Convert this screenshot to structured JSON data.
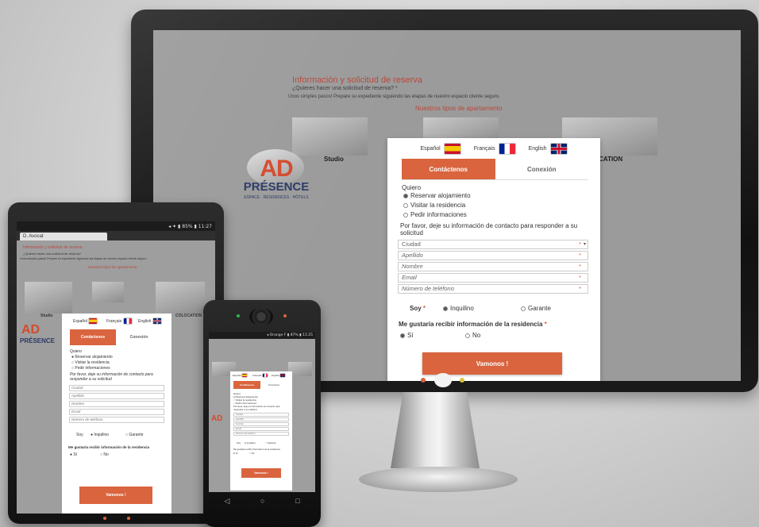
{
  "desktop": {
    "page_title": "Información y solicitud de reserva",
    "question": "¿Quieres hacer una solicitud de reserva? *",
    "intro": "Unos simples pasos! Prepare su expediente siguiendo las etapas de nuestro espacio cliente seguro.",
    "types_heading": "Nuestros tipos de apartamento",
    "tiles": [
      {
        "label": "Studio"
      },
      {
        "label": ""
      },
      {
        "label": "COLOCATION"
      }
    ],
    "logo": {
      "ad": "AD",
      "presence": "PRÉSENCE",
      "tagline": "ESPACE · RÉSIDENCES · HÔTELS"
    },
    "languages": [
      {
        "label": "Español",
        "flag": "flag-es-icon"
      },
      {
        "label": "Français",
        "flag": "flag-fr-icon"
      },
      {
        "label": "English",
        "flag": "flag-gb-icon"
      }
    ],
    "tabs": {
      "active": "Contáctenos",
      "other": "Conexión"
    },
    "quiero_label": "Quiero",
    "quiero_options": [
      {
        "label": "Reservar alojamiento",
        "selected": true
      },
      {
        "label": "Visitar la residencia",
        "selected": false
      },
      {
        "label": "Pedir informaciones",
        "selected": false
      }
    ],
    "contact_prompt": "Por favor, deje su información de contacto para responder a su solicitud",
    "fields": [
      {
        "placeholder": "Ciudad",
        "required": "*",
        "dropdown": "▾"
      },
      {
        "placeholder": "Apellido",
        "required": "*"
      },
      {
        "placeholder": "Nombre",
        "required": "*"
      },
      {
        "placeholder": "Email",
        "required": "*"
      },
      {
        "placeholder": "Número de teléfono",
        "required": "*"
      }
    ],
    "soy_label": "Soy",
    "soy_required": "*",
    "soy_options": [
      {
        "label": "Inquilino",
        "selected": true
      },
      {
        "label": "Garante",
        "selected": false
      }
    ],
    "info_question": "Me gustaría recibir información de la residencia",
    "info_required": "*",
    "info_options": [
      {
        "label": "Sí",
        "selected": true
      },
      {
        "label": "No",
        "selected": false
      }
    ],
    "submit_label": "Vamonos !"
  },
  "tablet": {
    "status": "◂ ✦ ▮ 85% ▮ 11:27",
    "browser_tab": "D. Avocat",
    "page_title": "Información y solicitud de reserva",
    "question": "¿Quieres hacer una solicitud de reserva?",
    "intro": "Unos simples pasos! Prepare su expediente siguiendo las etapas de nuestro espacio cliente seguro.",
    "types_heading": "Nuestros tipos de apartamento",
    "tile_labels": [
      "Studio",
      "",
      "COLOCATION"
    ],
    "logo": {
      "ad": "AD",
      "presence": "PRÉSENCE"
    },
    "languages": [
      "Español",
      "Français",
      "English"
    ],
    "tabs": {
      "active": "Contáctenos",
      "other": "Conexión"
    },
    "quiero_label": "Quiero",
    "quiero_options": [
      "Reservar alojamiento",
      "Visitar la residencia",
      "Pedir informaciones"
    ],
    "contact_prompt": "Por favor, deje su información de contacto para responder a su solicitud",
    "fields": [
      "Ciudad",
      "Apellido",
      "Nombre",
      "Email",
      "Número de teléfono"
    ],
    "soy_label": "Soy",
    "soy_options": [
      "Inquilino",
      "Garante"
    ],
    "info_question": "Me gustaría recibir información de la residencia",
    "info_options": [
      "Sí",
      "No"
    ],
    "submit_label": "Vamonos !"
  },
  "phone": {
    "status": "◂ Orange F ▮ 87% ▮ 11:25",
    "languages": [
      "Español",
      "Français",
      "English"
    ],
    "tabs": {
      "active": "Contáctenos",
      "other": "Conexión"
    },
    "logo": {
      "ad": "AD"
    },
    "quiero_label": "Quiero",
    "quiero_options": [
      "Reservar alojamiento",
      "Visitar la residencia",
      "Pedir informaciones"
    ],
    "contact_prompt": "Por favor, deje su información de contacto para responder a su solicitud",
    "fields": [
      "Ciudad",
      "Apellido",
      "Nombre",
      "Email",
      "Número de teléfono"
    ],
    "soy_label": "Soy",
    "soy_options": [
      "Inquilino",
      "Garante"
    ],
    "info_question": "Me gustaría recibir información de la residencia",
    "info_options": [
      "Sí",
      "No"
    ],
    "submit_label": "Vamonos !",
    "nav_icons": [
      "back-icon",
      "home-icon",
      "recent-apps-icon"
    ],
    "nav_glyphs": [
      "◁",
      "○",
      "□"
    ]
  },
  "colors": {
    "accent": "#d9643e",
    "title_red": "#b8493a",
    "logo_red": "#d44a2e",
    "logo_blue": "#2b3a67",
    "screen_bg": "#9b9b9b"
  }
}
